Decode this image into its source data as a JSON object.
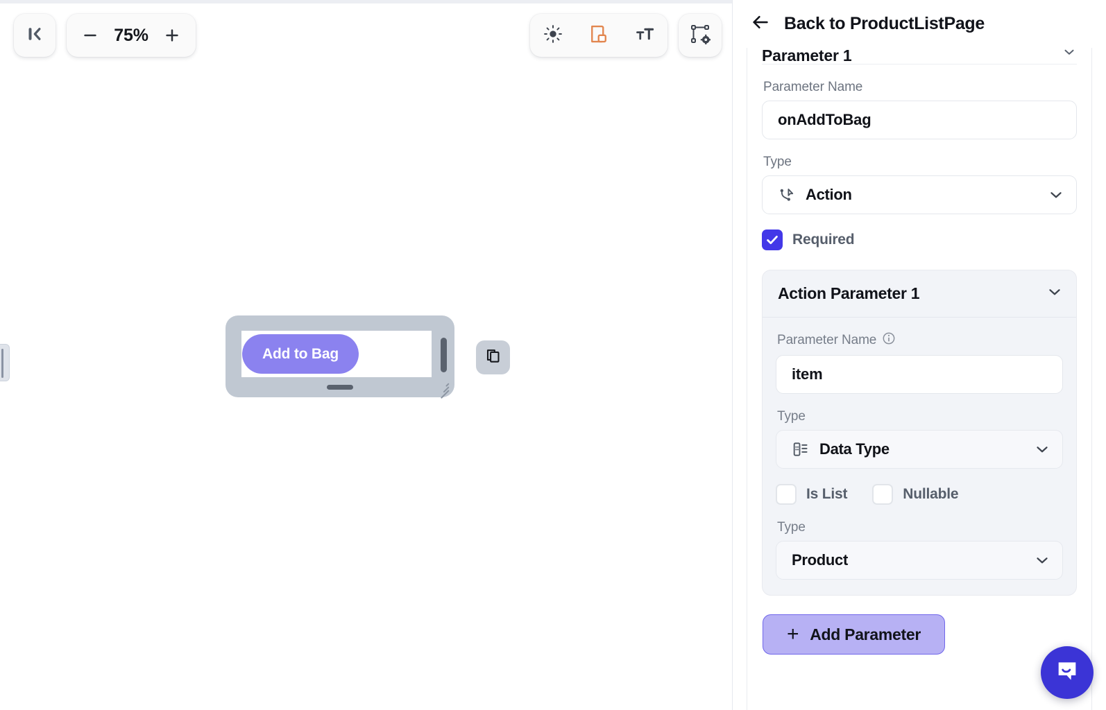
{
  "canvas": {
    "collapse_icon": "collapse-panel-left-icon",
    "zoom": {
      "minus_label": "−",
      "value": "75%",
      "plus_label": "+"
    },
    "toolbar": [
      {
        "icon": "brightness-sun-icon",
        "name": "theme-toggle"
      },
      {
        "icon": "page-layout-icon",
        "name": "layout-toggle",
        "color": "#e2864f"
      },
      {
        "icon": "text-size-icon",
        "name": "text-size-toggle"
      },
      {
        "icon": "component-settings-icon",
        "name": "component-settings"
      }
    ],
    "component": {
      "button_label": "Add to Bag",
      "button_color": "#8b82ef",
      "duplicate_icon": "duplicate-icon"
    }
  },
  "panel": {
    "back_icon": "arrow-left-icon",
    "title": "Back to ProductListPage",
    "collapsed_section_title": "Parameter 1",
    "parameter": {
      "name_label": "Parameter Name",
      "name_value": "onAddToBag",
      "type_label": "Type",
      "type_value": "Action",
      "type_icon": "action-pointer-icon",
      "required_label": "Required",
      "required_checked": true
    },
    "action_parameter": {
      "section_title": "Action Parameter 1",
      "name_label": "Parameter Name",
      "name_info_icon": "info-icon",
      "name_value": "item",
      "type_label": "Type",
      "type_value": "Data Type",
      "type_icon": "data-type-icon",
      "is_list_label": "Is List",
      "is_list_checked": false,
      "nullable_label": "Nullable",
      "nullable_checked": false,
      "datatype_label": "Type",
      "datatype_value": "Product"
    },
    "add_parameter_label": "Add Parameter",
    "add_parameter_plus": "+",
    "accent_color": "#4338e8"
  },
  "support": {
    "chat_icon": "chat-bubble-icon"
  }
}
